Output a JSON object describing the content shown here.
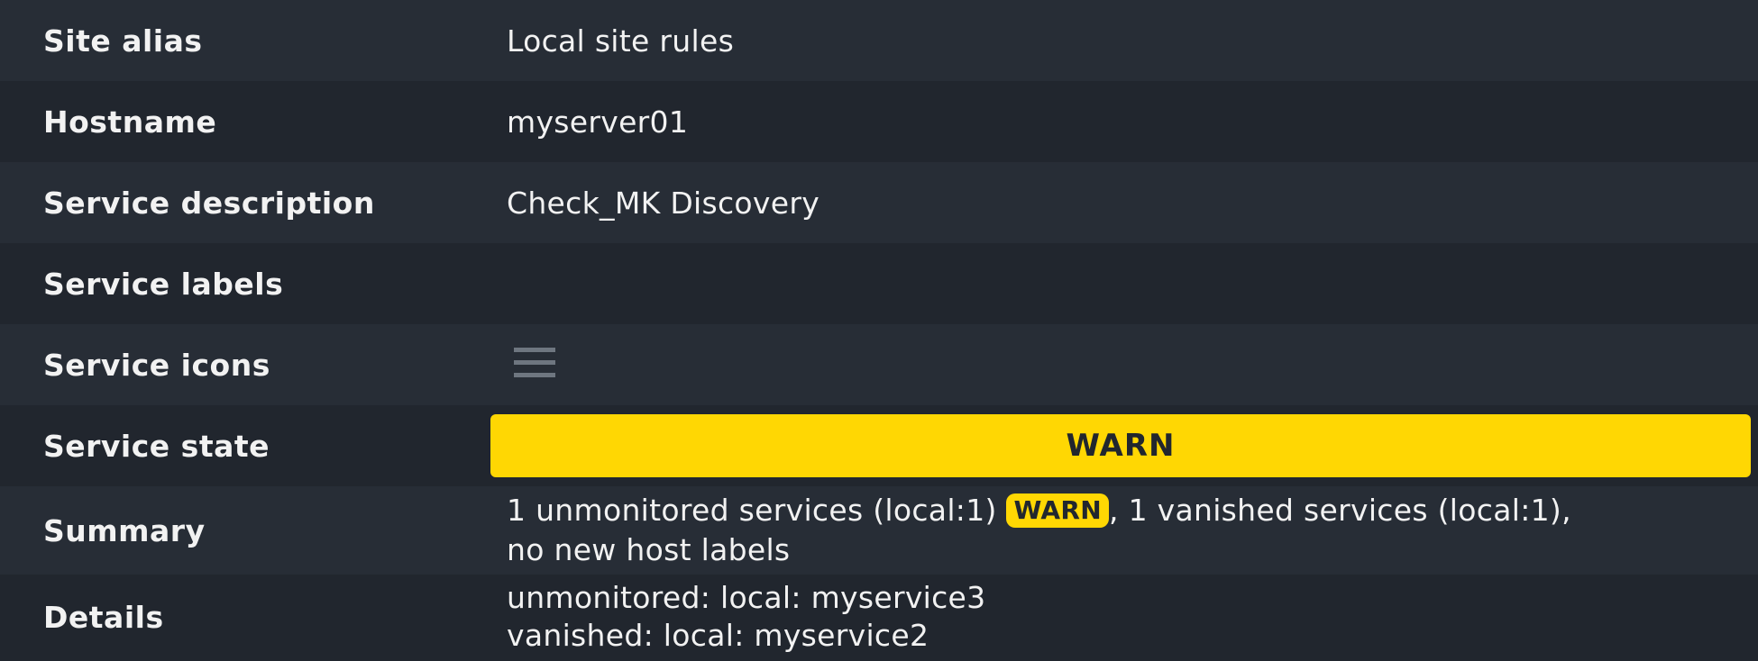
{
  "rows": [
    {
      "label": "Site alias",
      "value": "Local site rules"
    },
    {
      "label": "Hostname",
      "value": "myserver01"
    },
    {
      "label": "Service description",
      "value": "Check_MK Discovery"
    },
    {
      "label": "Service labels",
      "value": ""
    },
    {
      "label": "Service icons",
      "icon": "menu-icon"
    },
    {
      "label": "Service state",
      "value": "WARN",
      "color": "#ffd703"
    },
    {
      "label": "Summary",
      "line1_before": "1 unmonitored services (local:1) ",
      "line1_badge": "WARN",
      "line1_after": ", 1 vanished services (local:1),",
      "line2": "no new host labels"
    },
    {
      "label": "Details",
      "line1": "unmonitored: local: myservice3",
      "line2": "vanished: local: myservice2"
    }
  ]
}
